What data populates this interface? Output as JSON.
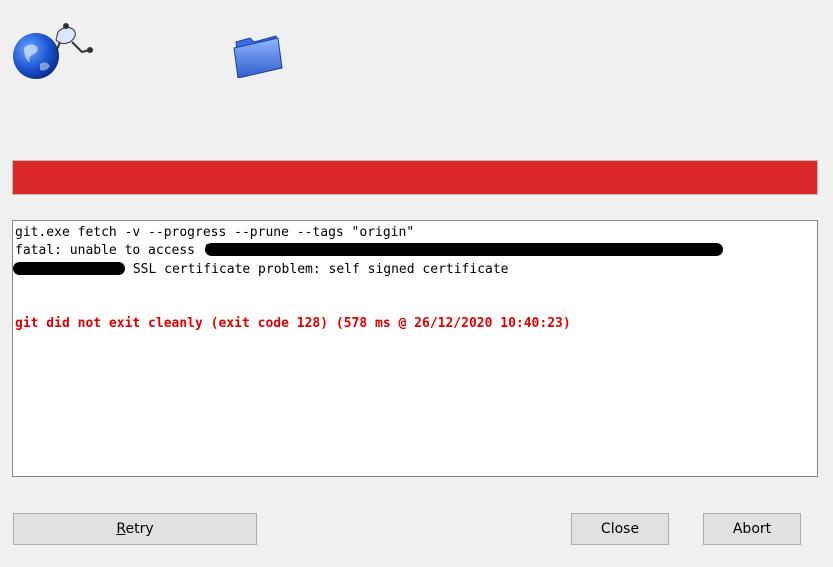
{
  "icons": {
    "globe": "globe-turtle-icon",
    "folder": "folder-icon"
  },
  "progress": {
    "value": 1.0,
    "color": "#dc2828"
  },
  "log": {
    "command": "git.exe fetch -v --progress --prune --tags \"origin\"",
    "fatal_prefix": "fatal: unable to access '",
    "ssl_message": "SSL certificate problem: self signed certificate",
    "error": "git did not exit cleanly (exit code 128) (578 ms @ 26/12/2020 10:40:23)",
    "error_color": "#e00000"
  },
  "buttons": {
    "retry_rest": "etry",
    "retry_mnemonic": "R",
    "close": "Close",
    "abort": "Abort"
  }
}
